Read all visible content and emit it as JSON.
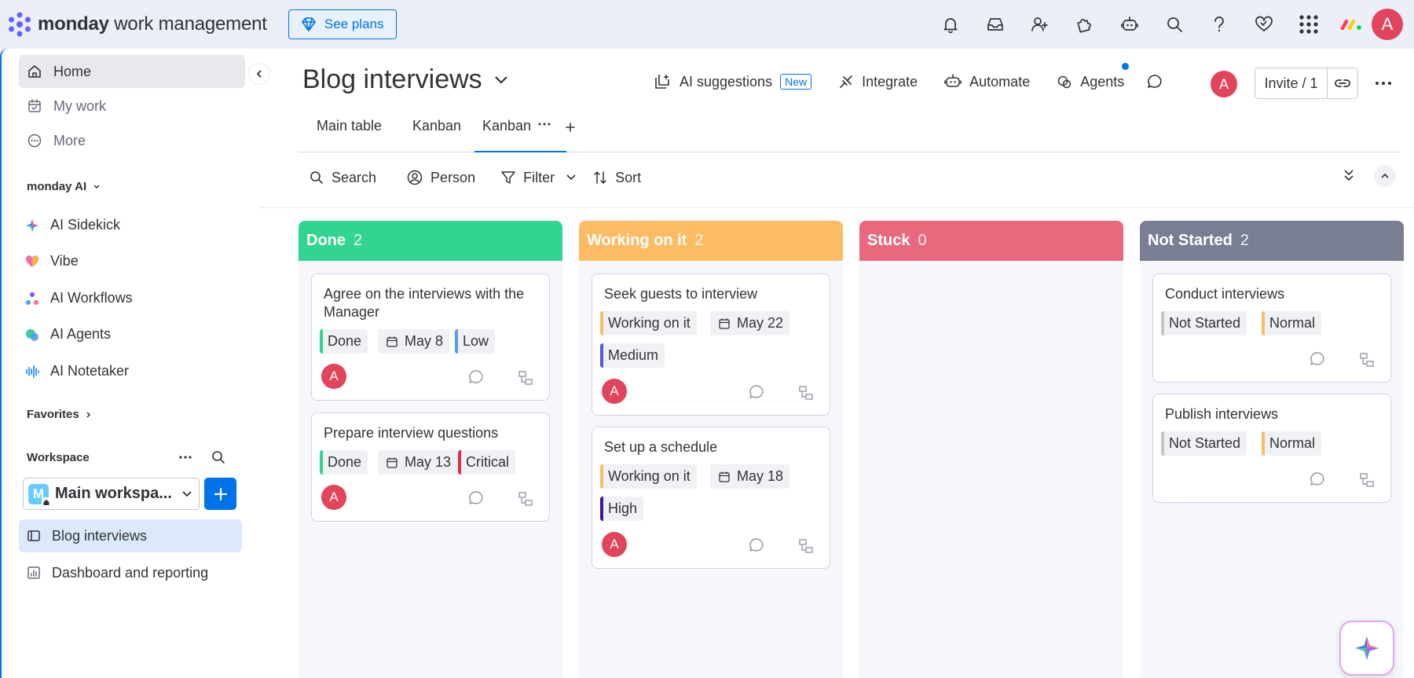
{
  "app": {
    "brand_bold": "monday",
    "brand_rest": " work management",
    "see_plans": "See plans",
    "avatar_initial": "A"
  },
  "sidebar": {
    "nav": [
      {
        "label": "Home",
        "icon": "home-icon"
      },
      {
        "label": "My work",
        "icon": "calendar-check-icon"
      },
      {
        "label": "More",
        "icon": "more-circle-icon"
      }
    ],
    "monday_ai_label": "monday AI",
    "ai_items": [
      {
        "label": "AI Sidekick",
        "icon": "sparkle-icon"
      },
      {
        "label": "Vibe",
        "icon": "heart-icon"
      },
      {
        "label": "AI Workflows",
        "icon": "workflow-icon"
      },
      {
        "label": "AI Agents",
        "icon": "agents-icon"
      },
      {
        "label": "AI Notetaker",
        "icon": "waveform-icon"
      }
    ],
    "favorites_label": "Favorites",
    "workspace_label": "Workspace",
    "workspace_badge": "M",
    "workspace_name": "Main workspa...",
    "boards": [
      {
        "label": "Blog interviews",
        "icon": "board-icon"
      },
      {
        "label": "Dashboard and reporting",
        "icon": "dashboard-icon"
      }
    ]
  },
  "board": {
    "title": "Blog interviews",
    "actions": {
      "ai_suggestions": "AI suggestions",
      "new_badge": "New",
      "integrate": "Integrate",
      "automate": "Automate",
      "agents": "Agents",
      "invite": "Invite / 1"
    },
    "tabs": [
      "Main table",
      "Kanban",
      "Kanban"
    ],
    "toolbar": {
      "search": "Search",
      "person": "Person",
      "filter": "Filter",
      "sort": "Sort"
    }
  },
  "colors": {
    "done": "#33d391",
    "working": "#fdbc64",
    "stuck": "#e8697d",
    "not_started": "#797e93",
    "low": "#579bfc",
    "critical": "#df2f4a",
    "medium": "#5559df",
    "high": "#401694",
    "normal": "#fdbc64"
  },
  "kanban": {
    "columns": [
      {
        "title": "Done",
        "count": "2",
        "cards": [
          {
            "title": "Agree on the interviews with the Manager",
            "status": "Done",
            "date": "May 8",
            "priority": "Low"
          },
          {
            "title": "Prepare interview questions",
            "status": "Done",
            "date": "May 13",
            "priority": "Critical"
          }
        ]
      },
      {
        "title": "Working on it",
        "count": "2",
        "cards": [
          {
            "title": "Seek guests to interview",
            "status": "Working on it",
            "date": "May 22",
            "priority": "Medium"
          },
          {
            "title": "Set up a schedule",
            "status": "Working on it",
            "date": "May 18",
            "priority": "High"
          }
        ]
      },
      {
        "title": "Stuck",
        "count": "0",
        "cards": []
      },
      {
        "title": "Not Started",
        "count": "2",
        "cards": [
          {
            "title": "Conduct interviews",
            "status": "Not Started",
            "priority": "Normal"
          },
          {
            "title": "Publish interviews",
            "status": "Not Started",
            "priority": "Normal"
          }
        ]
      }
    ]
  }
}
